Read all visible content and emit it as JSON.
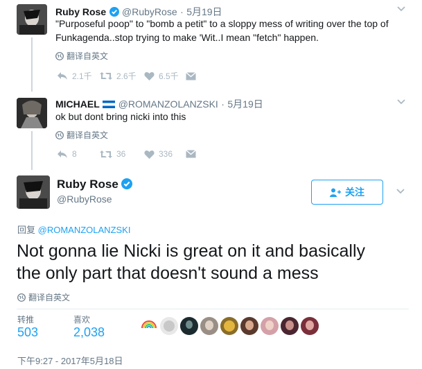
{
  "tweet1": {
    "name": "Ruby Rose",
    "handle": "@RubyRose",
    "sep": "·",
    "date": "5月19日",
    "text_line1": "\"Purposeful poop\" to \"bomb a petit\" to a sloppy mess of writing over the top of",
    "text_line2": "Funkagenda..stop trying to make 'Wit..I mean \"fetch\" happen.",
    "translate": "翻译自英文",
    "replies": "2.1千",
    "retweets": "2.6千",
    "likes": "6.5千"
  },
  "tweet2": {
    "name": "MICHAEL",
    "handle": "@ROMANZOLANZSKI",
    "sep": "·",
    "date": "5月19日",
    "text": "ok but dont bring nicki into this",
    "translate": "翻译自英文",
    "replies": "8",
    "retweets": "36",
    "likes": "336"
  },
  "main": {
    "name": "Ruby Rose",
    "handle": "@RubyRose",
    "follow_label": "关注",
    "reply_prefix": "回复",
    "reply_to": "@ROMANZOLANZSKI",
    "text_line1": "Not gonna lie Nicki is great on it and basically",
    "text_line2": "the only part that doesn't sound a mess",
    "translate": "翻译自英文",
    "retweets_label": "转推",
    "retweets_value": "503",
    "likes_label": "喜欢",
    "likes_value": "2,038",
    "timestamp": "下午9:27 - 2017年5月18日"
  },
  "colors": {
    "accent": "#1da1f2",
    "muted": "#657786",
    "icon": "#aab8c2"
  }
}
